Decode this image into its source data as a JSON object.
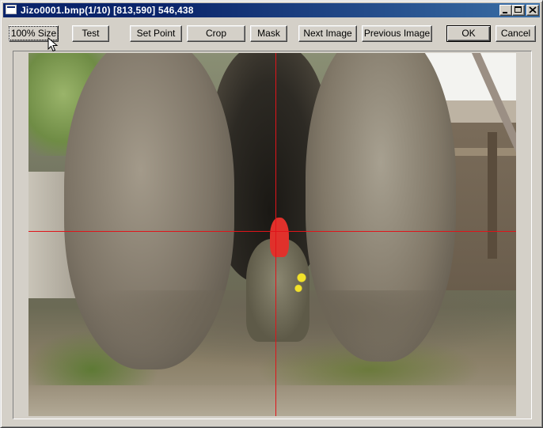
{
  "window": {
    "title": "Jizo0001.bmp(1/10) [813,590] 546,438"
  },
  "toolbar": {
    "size_label": "100% Size",
    "test_label": "Test",
    "set_point_label": "Set Point",
    "crop_label": "Crop",
    "mask_label": "Mask",
    "next_label": "Next Image",
    "previous_label": "Previous Image",
    "ok_label": "OK",
    "cancel_label": "Cancel"
  },
  "icons": {
    "app": "window-icon",
    "minimize": "minimize-icon",
    "maximize": "maximize-icon",
    "close": "close-icon",
    "cursor": "mouse-pointer-icon"
  },
  "colors": {
    "titlebar": "#0a246a",
    "face": "#d4d0c8",
    "crosshair": "#e0141a"
  }
}
